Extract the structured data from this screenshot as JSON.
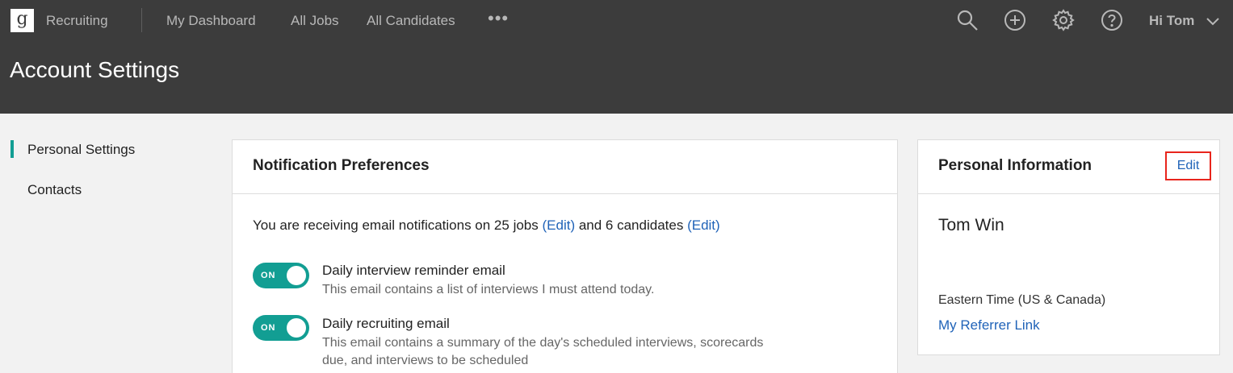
{
  "app": {
    "logo_letter": "g",
    "name": "Recruiting",
    "nav": [
      "My Dashboard",
      "All Jobs",
      "All Candidates"
    ],
    "more_label": "•••",
    "icons": [
      "search-icon",
      "add-icon",
      "gear-icon",
      "help-icon"
    ],
    "user_greeting": "Hi Tom"
  },
  "page": {
    "title": "Account Settings"
  },
  "sidebar": {
    "items": [
      {
        "label": "Personal Settings",
        "active": true
      },
      {
        "label": "Contacts",
        "active": false
      }
    ]
  },
  "notifications": {
    "title": "Notification Preferences",
    "summary_prefix": "You are receiving email notifications on 25 jobs ",
    "jobs_edit": "(Edit)",
    "summary_middle": " and 6 candidates ",
    "candidates_edit": "(Edit)",
    "options": [
      {
        "toggle": "ON",
        "title": "Daily interview reminder email",
        "description": "This email contains a list of interviews I must attend today."
      },
      {
        "toggle": "ON",
        "title": "Daily recruiting email",
        "description": "This email contains a summary of the day's scheduled interviews, scorecards due, and interviews to be scheduled"
      }
    ]
  },
  "personal": {
    "title": "Personal Information",
    "edit_label": "Edit",
    "name": "Tom Win",
    "timezone": "Eastern Time (US & Canada)",
    "referrer_link": "My Referrer Link"
  },
  "colors": {
    "header_bg": "#3c3c3c",
    "accent": "#129e93",
    "link": "#2063b8",
    "highlight": "#e8251c"
  }
}
